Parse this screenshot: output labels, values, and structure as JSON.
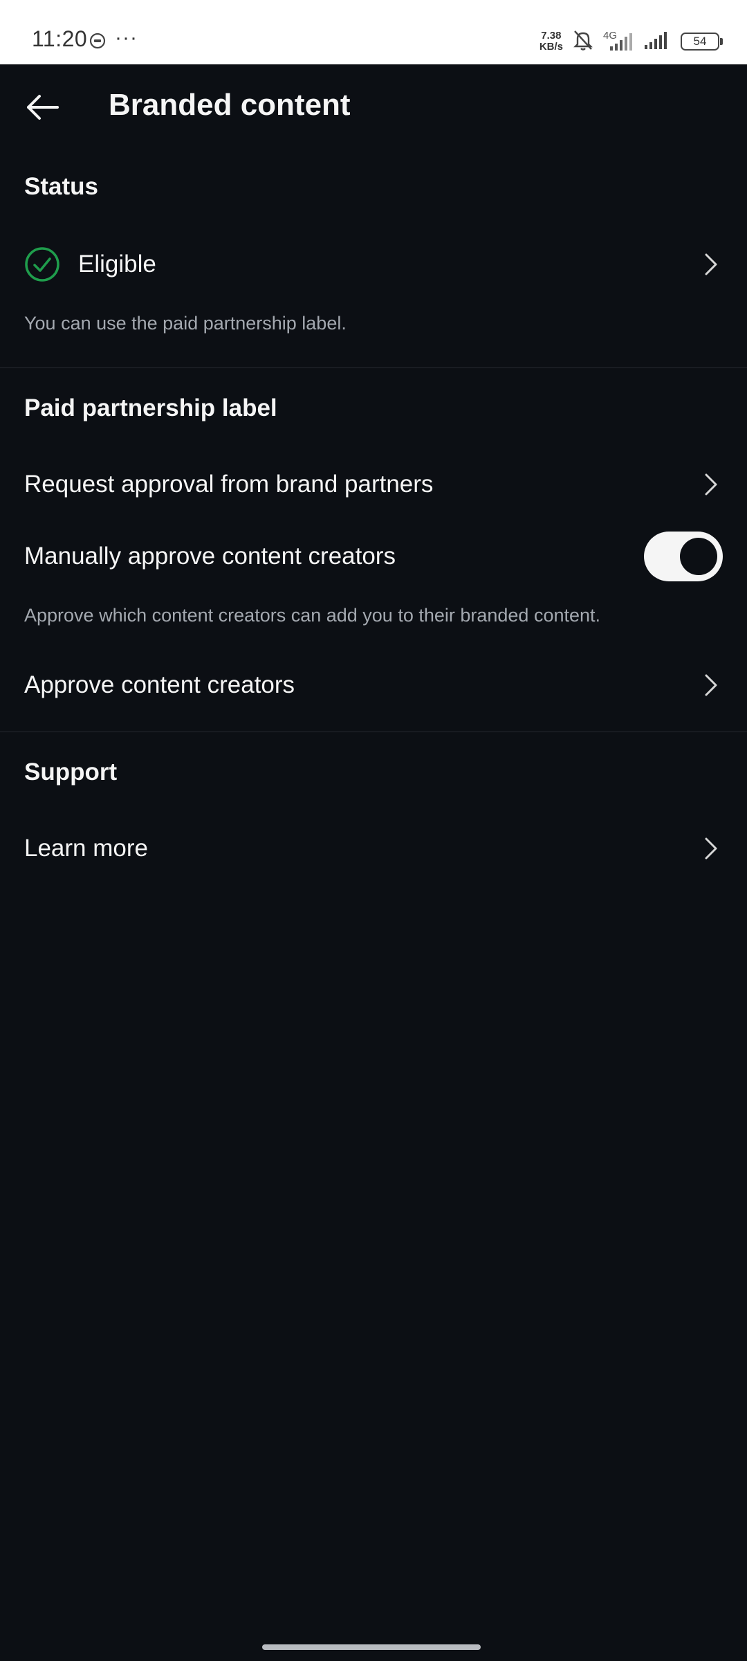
{
  "status_bar": {
    "time": "11:20",
    "more": "···",
    "speed_value": "7.38",
    "speed_unit": "KB/s",
    "network": "4G",
    "battery": "54"
  },
  "header": {
    "title": "Branded content"
  },
  "status_section": {
    "heading": "Status",
    "eligible_label": "Eligible",
    "description": "You can use the paid partnership label."
  },
  "paid_section": {
    "heading": "Paid partnership label",
    "request_approval_label": "Request approval from brand partners",
    "manual_approve_label": "Manually approve content creators",
    "manual_approve_enabled": true,
    "manual_approve_description": "Approve which content creators can add you to their branded content.",
    "approve_creators_label": "Approve content creators"
  },
  "support_section": {
    "heading": "Support",
    "learn_more_label": "Learn more"
  },
  "colors": {
    "background": "#0c0f14",
    "accent_green": "#1f9d4c",
    "text_primary": "#f5f5f5",
    "text_secondary": "#a4a9b0"
  }
}
